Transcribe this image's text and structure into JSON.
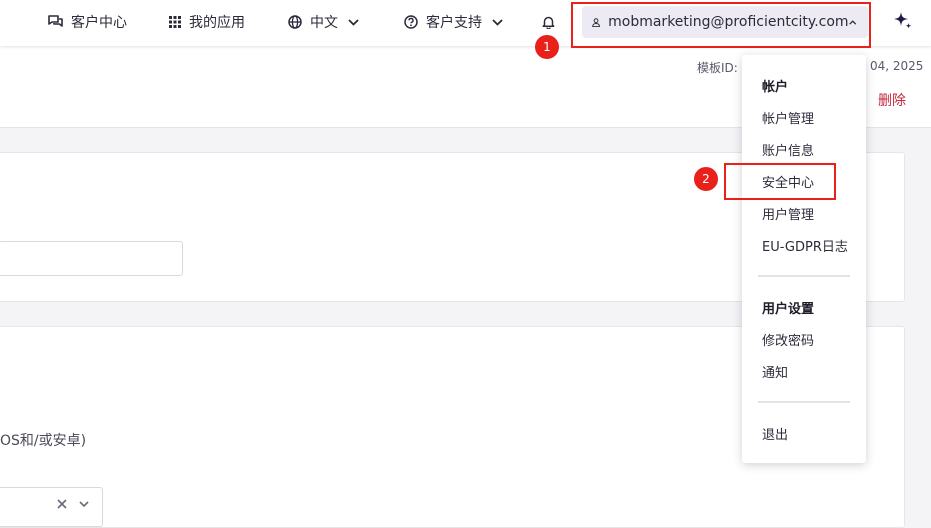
{
  "navbar": {
    "customer_center": "客户中心",
    "my_apps": "我的应用",
    "language": "中文",
    "support": "客户支持",
    "account_email": "mobmarketing@proficientcity.com"
  },
  "page": {
    "template_id_label": "模板ID:",
    "date_fragment": "04, 2025",
    "delete_label": "删除",
    "platform_text": "OS和/或安卓)"
  },
  "dropdown": {
    "sections": [
      {
        "title": "帐户",
        "items": [
          "帐户管理",
          "账户信息",
          "安全中心",
          "用户管理",
          "EU-GDPR日志"
        ]
      },
      {
        "title": "用户设置",
        "items": [
          "修改密码",
          "通知"
        ]
      }
    ],
    "logout": "退出"
  },
  "annotations": {
    "step1": "1",
    "step2": "2"
  },
  "colors": {
    "highlight": "#e8211a",
    "delete": "#c6253a",
    "account_pill": "#ecebf3"
  }
}
